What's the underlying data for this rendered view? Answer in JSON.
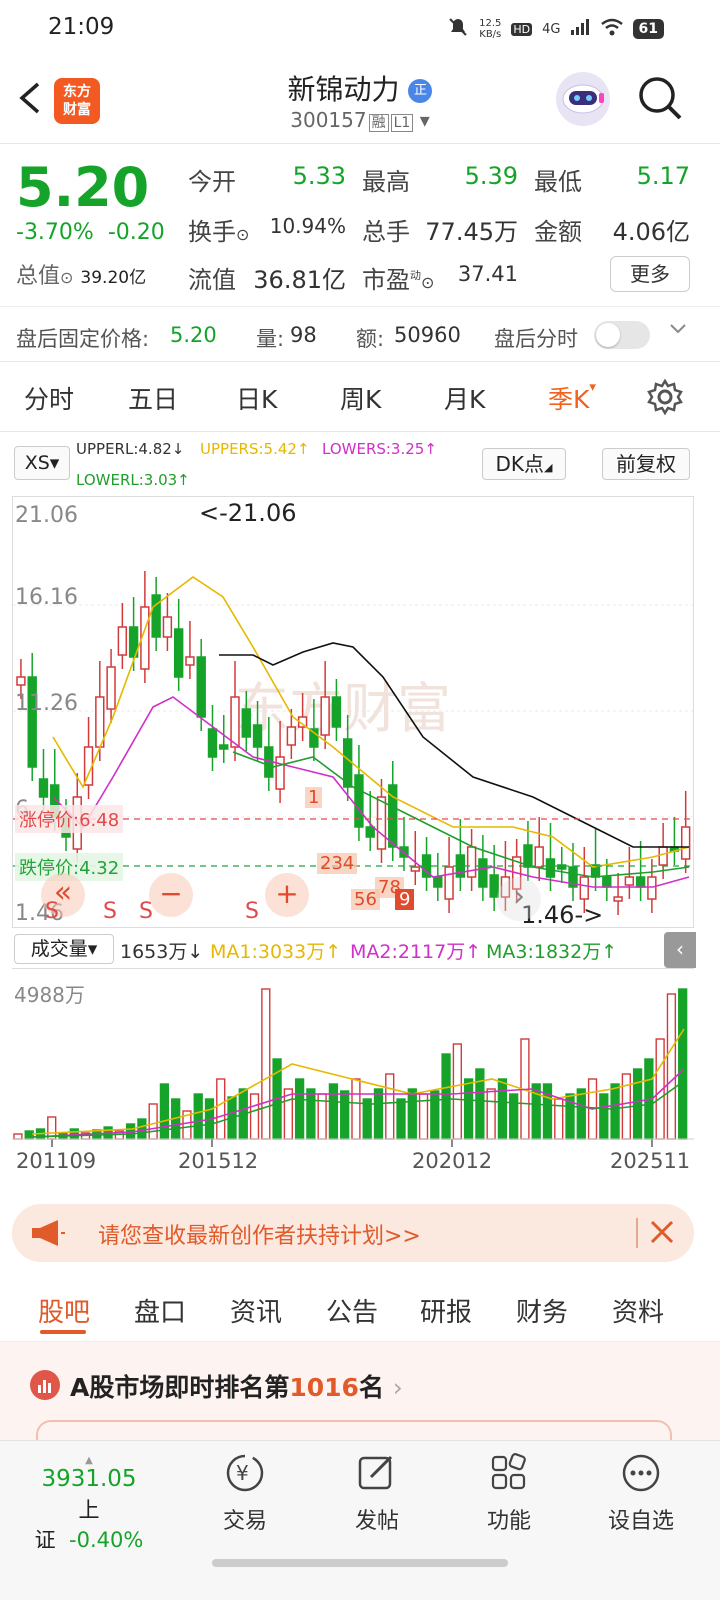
{
  "status": {
    "time": "21:09",
    "speed": "12.5",
    "speed_unit": "KB/s",
    "net": "4G",
    "battery": "61"
  },
  "header": {
    "logo_line1": "东方",
    "logo_line2": "财富",
    "stock_name": "新锦动力",
    "zheng_badge": "正",
    "code": "300157",
    "tag1": "融",
    "tag2": "L1"
  },
  "quote": {
    "price": "5.20",
    "pct": "-3.70%",
    "chg": "-0.20",
    "open_label": "今开",
    "open": "5.33",
    "high_label": "最高",
    "high": "5.39",
    "low_label": "最低",
    "low": "5.17",
    "turnover_label": "换手",
    "turnover": "10.94%",
    "vol_label": "总手",
    "vol": "77.45万",
    "amt_label": "金额",
    "amt": "4.06亿",
    "mktcap_label": "总值",
    "mktcap": "39.20亿",
    "float_label": "流值",
    "float": "36.81亿",
    "pe_label": "市盈",
    "pe_sup": "动",
    "pe": "37.41",
    "more": "更多"
  },
  "after_hours": {
    "price_label": "盘后固定价格:",
    "price": "5.20",
    "vol_label": "量:",
    "vol": "98",
    "amt_label": "额:",
    "amt": "50960",
    "timeshare_label": "盘后分时"
  },
  "period_tabs": [
    "分时",
    "五日",
    "日K",
    "周K",
    "月K",
    "季K"
  ],
  "kchart": {
    "xs_label": "XS",
    "upperl": "UPPERL:4.82↓",
    "uppers": "UPPERS:5.42↑",
    "lowers": "LOWERS:3.25↑",
    "lowerl": "LOWERL:3.03↑",
    "dk_label": "DK点",
    "fq_label": "前复权",
    "ymax": "21.06",
    "y2": "16.16",
    "y3": "11.26",
    "y4": "6.",
    "ymin": "1.46",
    "hi_annot": "<-21.06",
    "lo_annot": "1.46->",
    "limit_up_label": "涨停价:6.48",
    "limit_down_label": "跌停价:4.32",
    "watermark": "东方财富",
    "signals": [
      "1",
      "234",
      "56",
      "78",
      "9"
    ],
    "s_marks": [
      "S",
      "S",
      "S",
      "S"
    ],
    "ctrl_prev": "«",
    "ctrl_minus": "−",
    "ctrl_plus": "+",
    "ctrl_next": "›"
  },
  "volume": {
    "label": "成交量",
    "value": "1653万↓",
    "ma1": "MA1:3033万↑",
    "ma2": "MA2:2117万↑",
    "ma3": "MA3:1832万↑",
    "ymax": "4988万",
    "x_labels": [
      "201109",
      "201512",
      "202012",
      "202511"
    ]
  },
  "colors": {
    "up": "#d23a3a",
    "down": "#16a32a",
    "ma1": "#e6b800",
    "ma2": "#d02fc8",
    "ma3": "#1f9e2c",
    "ma4": "#111111",
    "accent": "#f0621e"
  },
  "chart_data": {
    "type": "candlestick",
    "period": "quarterly",
    "price_axis_ticks": [
      21.06,
      16.16,
      11.26,
      6.36,
      1.46
    ],
    "high": 21.06,
    "low": 1.46,
    "limit_up": 6.48,
    "limit_down": 4.32,
    "volume_max": "4988万"
  },
  "banner": {
    "text": "请您查收最新创作者扶持计划>>"
  },
  "bottom_tabs": [
    "股吧",
    "盘口",
    "资讯",
    "公告",
    "研报",
    "财务",
    "资料"
  ],
  "rank": {
    "prefix": "A股市场即时排名第",
    "num": "1016",
    "suffix": "名"
  },
  "bottom_nav": {
    "index_value": "3931.05",
    "index_name": "上证",
    "index_pct": "-0.40%",
    "trade": "交易",
    "post": "发帖",
    "func": "功能",
    "fav": "设自选"
  }
}
